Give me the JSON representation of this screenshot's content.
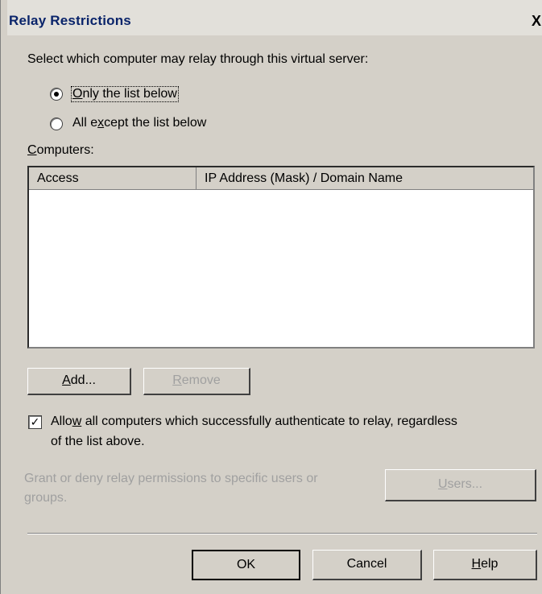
{
  "dialog": {
    "title": "Relay Restrictions",
    "close_glyph": "X"
  },
  "selection": {
    "prompt": "Select which computer may relay through this virtual server:",
    "options": [
      {
        "label_pre": "",
        "label_u": "O",
        "label_post": "nly the list below",
        "selected": true
      },
      {
        "label_pre": "All e",
        "label_u": "x",
        "label_post": "cept the list below",
        "selected": false
      }
    ]
  },
  "computers": {
    "label_u": "C",
    "label_post": "omputers:",
    "columns": [
      "Access",
      "IP Address (Mask) / Domain Name"
    ],
    "rows": []
  },
  "buttons": {
    "add": {
      "u": "A",
      "rest": "dd..."
    },
    "remove": {
      "u": "R",
      "rest": "emove"
    },
    "users": {
      "u": "U",
      "rest": "sers..."
    },
    "ok": "OK",
    "cancel": "Cancel",
    "help": {
      "u": "H",
      "rest": "elp"
    }
  },
  "auth": {
    "checked": true,
    "label_pre": "Allo",
    "label_u": "w",
    "label_line1_post": " all computers which successfully authenticate to relay, regardless",
    "label_line2": "of the list above."
  },
  "permissions": {
    "line1": "Grant or deny relay permissions to specific users or",
    "line2": "groups."
  },
  "colors": {
    "face": "#d4d0c8",
    "title_text": "#0a246a",
    "disabled_text": "#a0a0a0"
  }
}
